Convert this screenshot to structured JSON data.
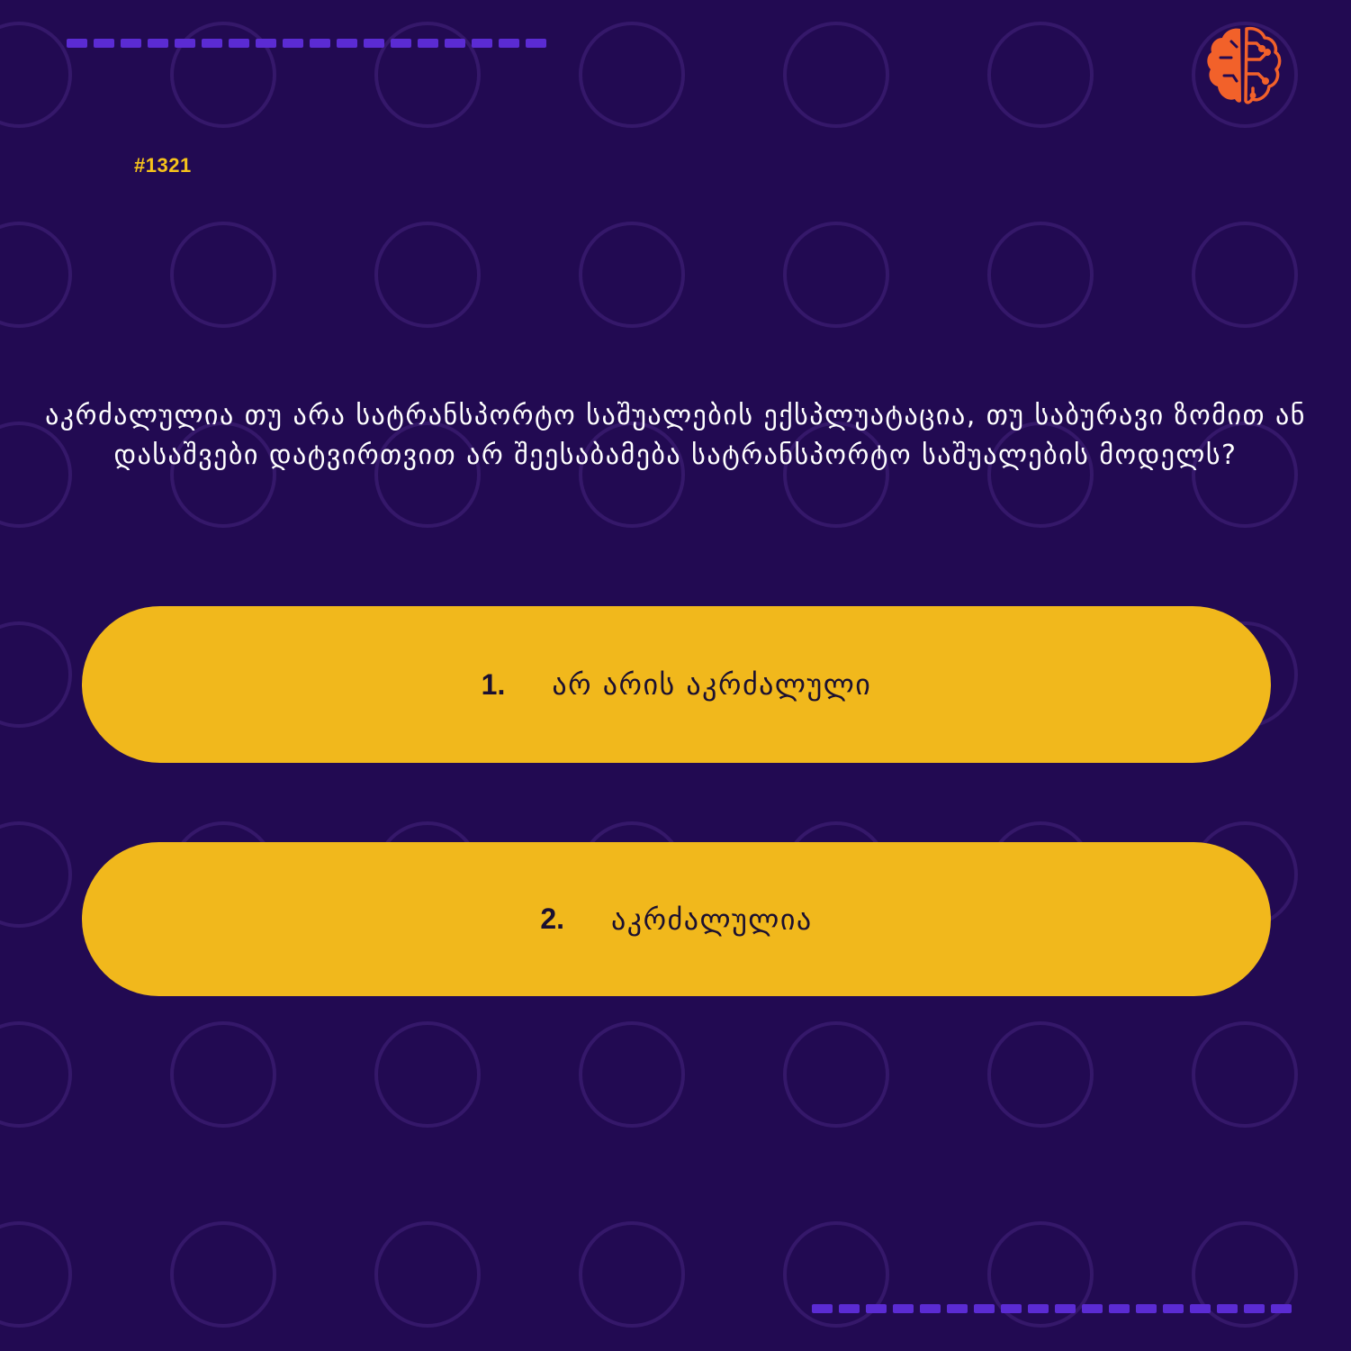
{
  "colors": {
    "background": "#220a52",
    "pattern_ring": "#35186a",
    "dash": "#5b2bd3",
    "accent_yellow": "#f1b81c",
    "question_number": "#f6c21b",
    "logo_orange": "#f2612a",
    "text_dark": "#1b1030"
  },
  "logo": {
    "icon": "brain-circuit-icon"
  },
  "question": {
    "number": "#1321",
    "text": "აკრძალულია თუ არა სატრანსპორტო საშუალების ექსპლუატაცია, თუ საბურავი ზომით ან დასაშვები დატვირთვით არ შეესაბამება სატრანსპორტო საშუალების მოდელს?"
  },
  "answers": [
    {
      "number": "1.",
      "label": "არ არის აკრძალული"
    },
    {
      "number": "2.",
      "label": "აკრძალულია"
    }
  ]
}
